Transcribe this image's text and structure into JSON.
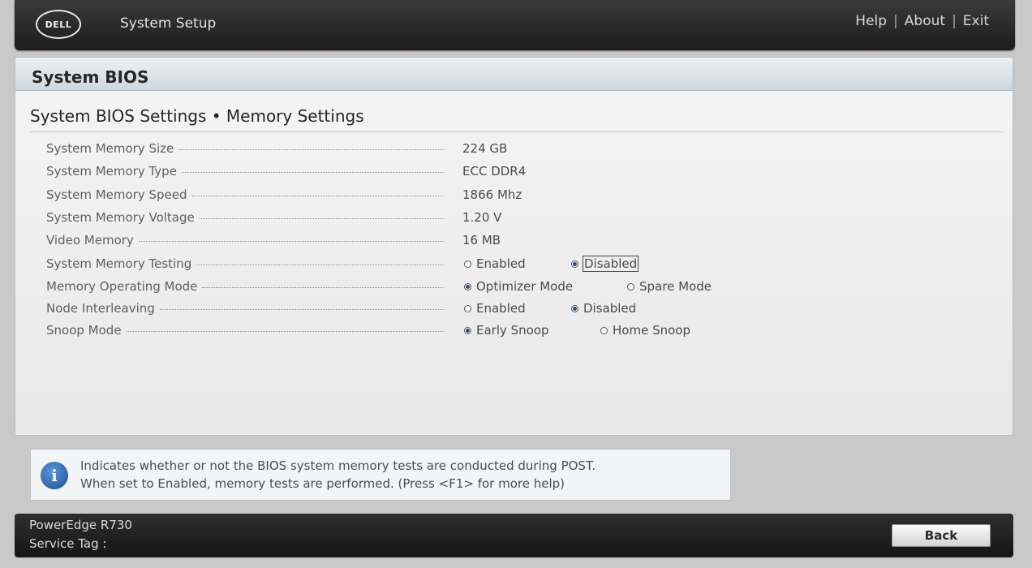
{
  "header": {
    "logo_text": "DELL",
    "app_title": "System Setup",
    "links": {
      "help": "Help",
      "about": "About",
      "exit": "Exit",
      "separator": "|"
    }
  },
  "panel": {
    "title": "System BIOS",
    "breadcrumb": "System BIOS Settings • Memory Settings"
  },
  "settings": [
    {
      "label": "System Memory Size",
      "value": "224 GB"
    },
    {
      "label": "System Memory Type",
      "value": "ECC DDR4"
    },
    {
      "label": "System Memory Speed",
      "value": "1866 Mhz"
    },
    {
      "label": "System Memory Voltage",
      "value": "1.20 V"
    },
    {
      "label": "Video Memory",
      "value": "16 MB"
    },
    {
      "label": "System Memory Testing",
      "options": [
        "Enabled",
        "Disabled"
      ],
      "selected": "Disabled"
    },
    {
      "label": "Memory Operating Mode",
      "options": [
        "Optimizer Mode",
        "Spare Mode"
      ],
      "selected": "Optimizer Mode"
    },
    {
      "label": "Node Interleaving",
      "options": [
        "Enabled",
        "Disabled"
      ],
      "selected": "Disabled"
    },
    {
      "label": "Snoop Mode",
      "options": [
        "Early Snoop",
        "Home Snoop"
      ],
      "selected": "Early Snoop"
    }
  ],
  "help": {
    "line1": "Indicates whether or not the BIOS system memory tests are conducted during POST.",
    "line2": "When set to Enabled, memory tests are performed. (Press <F1> for more help)",
    "icon": "info-icon"
  },
  "footer": {
    "model": "PowerEdge R730",
    "service_tag_label": "Service Tag :",
    "back_label": "Back"
  },
  "colors": {
    "accent_radio": "#2b4e7c",
    "header_bg": "#1c1c1c",
    "panel_bg": "#f0f0f0"
  }
}
